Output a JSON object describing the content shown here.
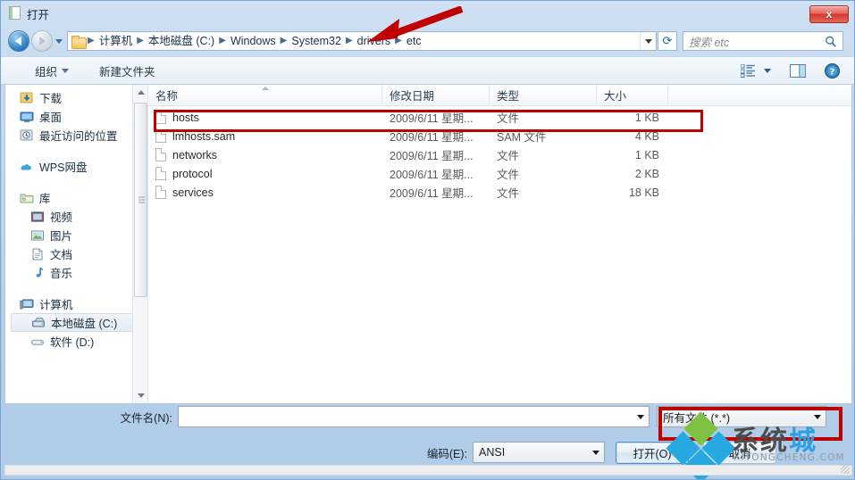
{
  "window": {
    "title": "打开",
    "title_icon": "document-icon",
    "close_label": "x"
  },
  "navigation": {
    "back_icon": "back-arrow-icon",
    "forward_icon": "forward-arrow-icon",
    "history_icon": "chevron-down-icon",
    "refresh_icon": "refresh-icon",
    "refresh_glyph": "⟳",
    "breadcrumbs": [
      "计算机",
      "本地磁盘 (C:)",
      "Windows",
      "System32",
      "drivers",
      "etc"
    ],
    "separator": "▶"
  },
  "search": {
    "placeholder": "搜索 etc",
    "icon": "search-icon"
  },
  "toolbar": {
    "organize_label": "组织",
    "new_folder_label": "新建文件夹",
    "view_icon": "list-view-icon",
    "view_caret_icon": "chevron-down-icon",
    "preview_pane_icon": "preview-pane-icon",
    "help_icon": "help-icon"
  },
  "sidebar": {
    "groups": [
      {
        "items": [
          {
            "label": "下载",
            "icon": "downloads-icon",
            "indent": false,
            "selected": false
          },
          {
            "label": "桌面",
            "icon": "desktop-icon",
            "indent": false,
            "selected": false
          },
          {
            "label": "最近访问的位置",
            "icon": "recent-places-icon",
            "indent": false,
            "selected": false
          }
        ]
      },
      {
        "items": [
          {
            "label": "WPS网盘",
            "icon": "cloud-icon",
            "indent": false,
            "selected": false
          }
        ]
      },
      {
        "items": [
          {
            "label": "库",
            "icon": "library-icon",
            "indent": false,
            "selected": false
          },
          {
            "label": "视频",
            "icon": "video-icon",
            "indent": true,
            "selected": false
          },
          {
            "label": "图片",
            "icon": "pictures-icon",
            "indent": true,
            "selected": false
          },
          {
            "label": "文档",
            "icon": "documents-icon",
            "indent": true,
            "selected": false
          },
          {
            "label": "音乐",
            "icon": "music-icon",
            "indent": true,
            "selected": false
          }
        ]
      },
      {
        "items": [
          {
            "label": "计算机",
            "icon": "computer-icon",
            "indent": false,
            "selected": false
          },
          {
            "label": "本地磁盘 (C:)",
            "icon": "hard-drive-icon",
            "indent": true,
            "selected": true
          },
          {
            "label": "软件 (D:)",
            "icon": "drive-icon",
            "indent": true,
            "selected": false
          }
        ]
      }
    ],
    "scroll_up_icon": "scroll-up-arrow-icon",
    "scroll_down_icon": "scroll-down-arrow-icon"
  },
  "filelist": {
    "columns": [
      "名称",
      "修改日期",
      "类型",
      "大小"
    ],
    "sort_column": "名称",
    "sort_direction": "ascending",
    "rows": [
      {
        "name": "hosts",
        "date": "2009/6/11 星期...",
        "type": "文件",
        "size": "1 KB",
        "highlighted": true
      },
      {
        "name": "lmhosts.sam",
        "date": "2009/6/11 星期...",
        "type": "SAM 文件",
        "size": "4 KB",
        "highlighted": false
      },
      {
        "name": "networks",
        "date": "2009/6/11 星期...",
        "type": "文件",
        "size": "1 KB",
        "highlighted": false
      },
      {
        "name": "protocol",
        "date": "2009/6/11 星期...",
        "type": "文件",
        "size": "2 KB",
        "highlighted": false
      },
      {
        "name": "services",
        "date": "2009/6/11 星期...",
        "type": "文件",
        "size": "18 KB",
        "highlighted": false
      }
    ]
  },
  "form": {
    "filename_label": "文件名(N):",
    "filename_value": "",
    "filetype_value": "所有文件 (*.*)",
    "encoding_label": "编码(E):",
    "encoding_value": "ANSI",
    "open_button": "打开(O)",
    "cancel_button": "取消"
  },
  "annotations": {
    "arrow_color": "#c00000",
    "highlight_color": "#c00000"
  },
  "watermark": {
    "text_dark": "系统",
    "text_blue": "城",
    "subtitle": "XITONGCHENG.COM",
    "green": "#7dc242",
    "blue": "#26a9e0"
  }
}
